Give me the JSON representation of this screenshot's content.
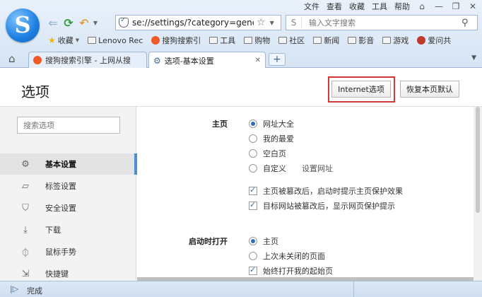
{
  "menubar": {
    "items": [
      "文件",
      "查看",
      "收藏",
      "工具",
      "帮助"
    ],
    "window_buttons": [
      "⌂",
      "—",
      "❐",
      "✕"
    ]
  },
  "nav": {
    "back_icon": "back-arrow-icon",
    "refresh_icon": "refresh-icon",
    "undo_icon": "undo-icon"
  },
  "address": {
    "url": "se://settings/?category=general"
  },
  "search": {
    "placeholder": "输入文字搜索"
  },
  "favorites": [
    {
      "label": "收藏",
      "icon": "star-icon"
    },
    {
      "label": "Lenovo Rec",
      "icon": "folder-icon"
    },
    {
      "label": "搜狗搜索引",
      "icon": "sogou-icon"
    },
    {
      "label": "工具",
      "icon": "folder-icon"
    },
    {
      "label": "购物",
      "icon": "folder-icon"
    },
    {
      "label": "社区",
      "icon": "folder-icon"
    },
    {
      "label": "新闻",
      "icon": "folder-icon"
    },
    {
      "label": "影音",
      "icon": "folder-icon"
    },
    {
      "label": "游戏",
      "icon": "folder-icon"
    },
    {
      "label": "爱问共",
      "icon": "avatar-icon"
    }
  ],
  "tabs": [
    {
      "label": "搜狗搜索引擎 - 上网从搜",
      "active": false
    },
    {
      "label": "选项-基本设置",
      "active": true
    }
  ],
  "page": {
    "title": "选项",
    "internet_options_label": "Internet选项",
    "reset_label": "恢复本页默认",
    "search_placeholder": "搜索选项"
  },
  "sidebar": [
    {
      "label": "基本设置",
      "icon": "gear-icon",
      "active": true
    },
    {
      "label": "标签设置",
      "icon": "tab-icon",
      "active": false
    },
    {
      "label": "安全设置",
      "icon": "shield-icon",
      "active": false
    },
    {
      "label": "下载",
      "icon": "download-icon",
      "active": false
    },
    {
      "label": "鼠标手势",
      "icon": "mouse-icon",
      "active": false
    },
    {
      "label": "快捷键",
      "icon": "shortcut-icon",
      "active": false
    }
  ],
  "sections": {
    "homepage": {
      "title": "主页",
      "options": [
        {
          "label": "网址大全",
          "selected": true
        },
        {
          "label": "我的最爱",
          "selected": false
        },
        {
          "label": "空白页",
          "selected": false
        },
        {
          "label": "自定义",
          "selected": false
        }
      ],
      "custom_link": "设置网址",
      "checks": [
        {
          "label": "主页被篡改后，启动时提示主页保护效果",
          "checked": true
        },
        {
          "label": "目标网站被篡改后，显示网页保护提示",
          "checked": true
        }
      ]
    },
    "startup": {
      "title": "启动时打开",
      "options": [
        {
          "label": "主页",
          "selected": true
        },
        {
          "label": "上次未关闭的页面",
          "selected": false
        }
      ],
      "checks": [
        {
          "label": "始终打开我的起始页",
          "checked": true
        }
      ]
    }
  },
  "status": {
    "text": "完成"
  },
  "colors": {
    "accent": "#2f6fb8",
    "highlight_border": "#d03a3a",
    "active_bar": "#4a90d9"
  }
}
